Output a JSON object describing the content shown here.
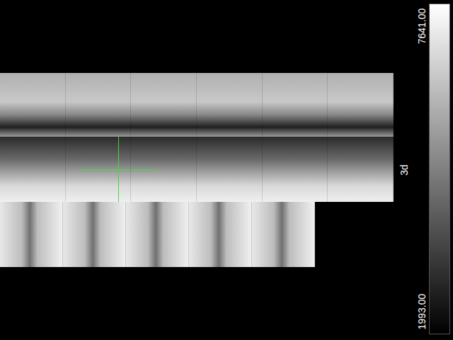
{
  "viewer": {
    "label": "3d",
    "crosshair": {
      "visible": true
    }
  },
  "colorbar": {
    "max": "7641.00",
    "min": "1993.00"
  }
}
